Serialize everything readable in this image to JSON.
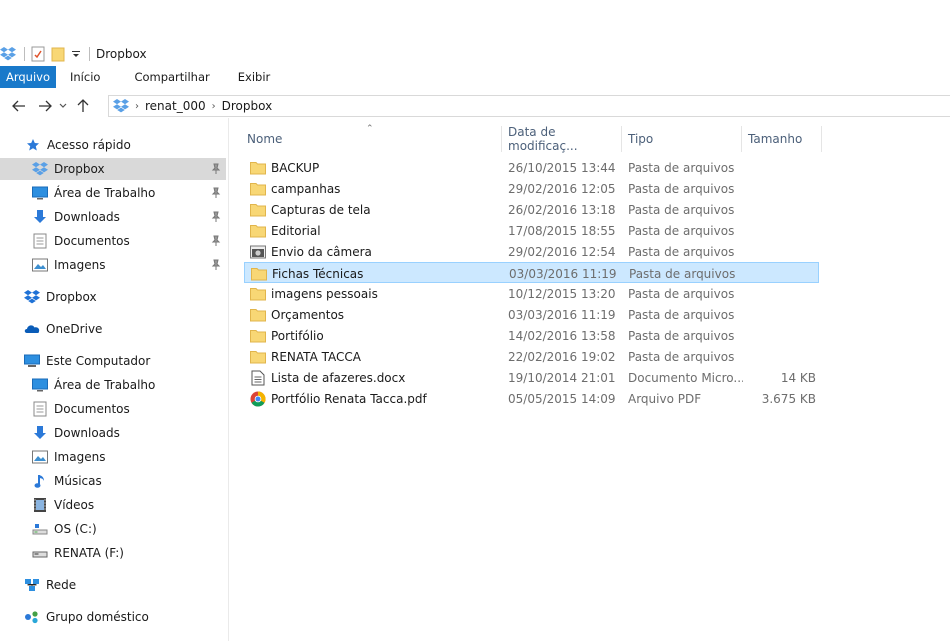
{
  "window": {
    "title": "Dropbox"
  },
  "ribbon": {
    "tabs": [
      {
        "label": "Arquivo"
      },
      {
        "label": "Início"
      },
      {
        "label": "Compartilhar"
      },
      {
        "label": "Exibir"
      }
    ]
  },
  "address": {
    "crumbs": [
      "renat_000",
      "Dropbox"
    ]
  },
  "sidebar": {
    "quick_access": "Acesso rápido",
    "quick_items": [
      {
        "label": "Dropbox",
        "icon": "dropbox-icon"
      },
      {
        "label": "Área de Trabalho",
        "icon": "desktop-icon"
      },
      {
        "label": "Downloads",
        "icon": "downloads-icon"
      },
      {
        "label": "Documentos",
        "icon": "documents-icon"
      },
      {
        "label": "Imagens",
        "icon": "pictures-icon"
      }
    ],
    "dropbox": "Dropbox",
    "onedrive": "OneDrive",
    "this_pc": "Este Computador",
    "pc_items": [
      {
        "label": "Área de Trabalho",
        "icon": "desktop-icon"
      },
      {
        "label": "Documentos",
        "icon": "documents-icon"
      },
      {
        "label": "Downloads",
        "icon": "downloads-icon"
      },
      {
        "label": "Imagens",
        "icon": "pictures-icon"
      },
      {
        "label": "Músicas",
        "icon": "music-icon"
      },
      {
        "label": "Vídeos",
        "icon": "videos-icon"
      },
      {
        "label": "OS (C:)",
        "icon": "drive-c-icon"
      },
      {
        "label": "RENATA (F:)",
        "icon": "drive-f-icon"
      }
    ],
    "network": "Rede",
    "homegroup": "Grupo doméstico"
  },
  "columns": {
    "name": "Nome",
    "date": "Data de modificaç...",
    "type": "Tipo",
    "size": "Tamanho"
  },
  "files": [
    {
      "name": "BACKUP",
      "date": "26/10/2015 13:44",
      "type": "Pasta de arquivos",
      "size": "",
      "icon": "folder-icon"
    },
    {
      "name": "campanhas",
      "date": "29/02/2016 12:05",
      "type": "Pasta de arquivos",
      "size": "",
      "icon": "folder-icon"
    },
    {
      "name": "Capturas de tela",
      "date": "26/02/2016 13:18",
      "type": "Pasta de arquivos",
      "size": "",
      "icon": "folder-icon"
    },
    {
      "name": "Editorial",
      "date": "17/08/2015 18:55",
      "type": "Pasta de arquivos",
      "size": "",
      "icon": "folder-icon"
    },
    {
      "name": "Envio da câmera",
      "date": "29/02/2016 12:54",
      "type": "Pasta de arquivos",
      "size": "",
      "icon": "camera-folder-icon"
    },
    {
      "name": "Fichas Técnicas",
      "date": "03/03/2016 11:19",
      "type": "Pasta de arquivos",
      "size": "",
      "icon": "folder-icon"
    },
    {
      "name": "imagens pessoais",
      "date": "10/12/2015 13:20",
      "type": "Pasta de arquivos",
      "size": "",
      "icon": "folder-icon"
    },
    {
      "name": "Orçamentos",
      "date": "03/03/2016 11:19",
      "type": "Pasta de arquivos",
      "size": "",
      "icon": "folder-icon"
    },
    {
      "name": "Portifólio",
      "date": "14/02/2016 13:58",
      "type": "Pasta de arquivos",
      "size": "",
      "icon": "folder-icon"
    },
    {
      "name": "RENATA TACCA",
      "date": "22/02/2016 19:02",
      "type": "Pasta de arquivos",
      "size": "",
      "icon": "folder-icon"
    },
    {
      "name": "Lista de afazeres.docx",
      "date": "19/10/2014 21:01",
      "type": "Documento Micro...",
      "size": "14 KB",
      "icon": "word-doc-icon"
    },
    {
      "name": "Portfólio Renata Tacca.pdf",
      "date": "05/05/2015 14:09",
      "type": "Arquivo PDF",
      "size": "3.675 KB",
      "icon": "chrome-pdf-icon"
    }
  ],
  "selected_file": "Fichas Técnicas",
  "colors": {
    "accent": "#1979ca",
    "selection": "#cce8ff",
    "selection_border": "#99d1ff",
    "folder": "#f8d775"
  }
}
